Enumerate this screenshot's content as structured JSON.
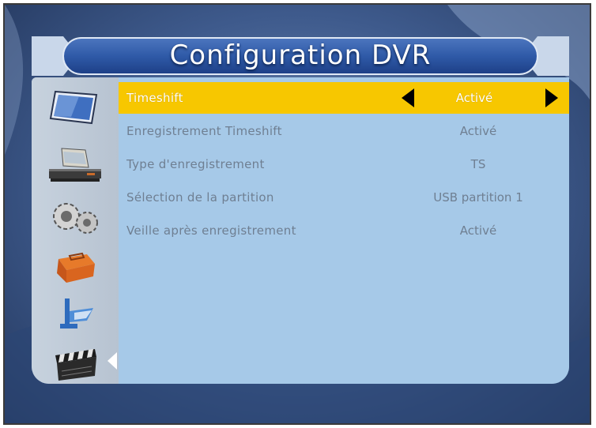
{
  "screen": {
    "title": "Configuration DVR"
  },
  "sidebar": {
    "icons": [
      "monitor-icon",
      "receiver-icon",
      "gears-icon",
      "toolbox-icon",
      "signal-icon",
      "clapperboard-icon"
    ],
    "active_index": 5
  },
  "menu": {
    "selected_index": 0,
    "rows": [
      {
        "label": "Timeshift",
        "value": "Activé"
      },
      {
        "label": "Enregistrement Timeshift",
        "value": "Activé"
      },
      {
        "label": "Type d'enregistrement",
        "value": "TS"
      },
      {
        "label": "Sélection de la partition",
        "value": "USB partition 1"
      },
      {
        "label": "Veille après enregistrement",
        "value": "Activé"
      }
    ]
  },
  "colors": {
    "highlight": "#f7c700",
    "panel": "#a6c9e8",
    "text_inactive": "#6f7f92",
    "text_active": "#ffffff"
  }
}
